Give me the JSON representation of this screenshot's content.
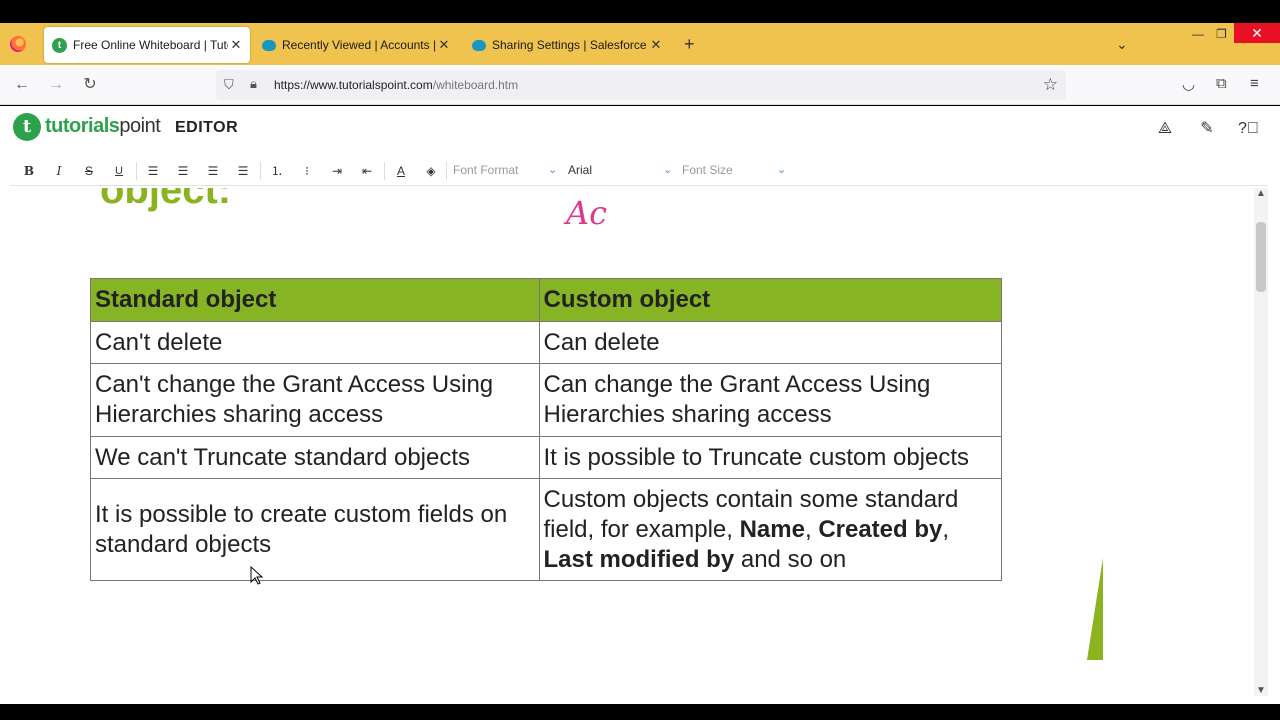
{
  "browser": {
    "tabs": [
      {
        "title": "Free Online Whiteboard | Tutori",
        "active": true,
        "favicon": "tutorialspoint-icon"
      },
      {
        "title": "Recently Viewed | Accounts | Sa",
        "active": false,
        "favicon": "salesforce-icon"
      },
      {
        "title": "Sharing Settings | Salesforce",
        "active": false,
        "favicon": "salesforce-icon"
      }
    ],
    "url_host": "https://www.tutorialspoint.com",
    "url_path": "/whiteboard.htm"
  },
  "app": {
    "logo_brand": "tutorials",
    "logo_suffix": "point",
    "title": "EDITOR"
  },
  "toolbar": {
    "bold": "B",
    "italic": "I",
    "strike": "S",
    "underline": "U",
    "font_format_placeholder": "Font Format",
    "font_family_value": "Arial",
    "font_size_placeholder": "Font Size"
  },
  "canvas": {
    "partial_heading": "object:",
    "handwriting": "Ac"
  },
  "table": {
    "headers": [
      "Standard object",
      "Custom object"
    ],
    "rows": [
      [
        "Can't delete",
        "Can delete"
      ],
      [
        "Can't change the Grant Access Using Hierarchies sharing access",
        "Can change the Grant Access Using Hierarchies sharing access"
      ],
      [
        "We can't Truncate standard objects",
        "It is possible to Truncate custom objects"
      ]
    ],
    "last_row": {
      "left": "It is possible to create custom fields on standard objects",
      "right_intro": "Custom objects contain some standard field, for example, ",
      "right_bold_1": "Name",
      "right_sep_1": ", ",
      "right_bold_2": "Created by",
      "right_sep_2": ", ",
      "right_bold_3": "Last modified by",
      "right_outro": " and so on"
    }
  },
  "colors": {
    "tab_strip": "#efc34e",
    "table_header": "#86b424",
    "brand_green": "#2ca24c",
    "handwriting": "#e0378b"
  }
}
